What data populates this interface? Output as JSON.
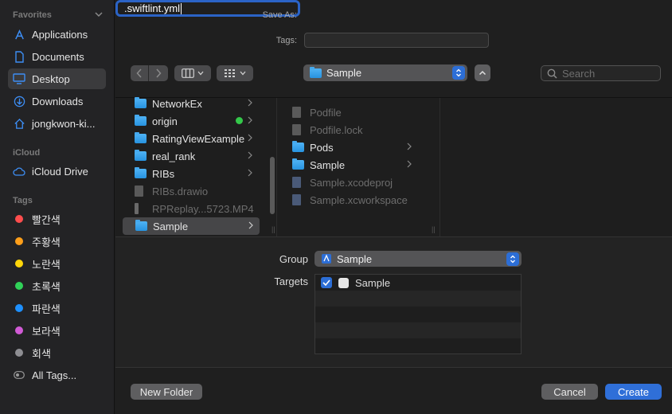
{
  "sidebar": {
    "favorites_label": "Favorites",
    "favorites": [
      {
        "label": "Applications",
        "icon": "applications-icon"
      },
      {
        "label": "Documents",
        "icon": "document-icon"
      },
      {
        "label": "Desktop",
        "icon": "desktop-icon",
        "selected": true
      },
      {
        "label": "Downloads",
        "icon": "downloads-icon"
      },
      {
        "label": "jongkwon-ki...",
        "icon": "home-icon"
      }
    ],
    "icloud_label": "iCloud",
    "icloud_drive": "iCloud Drive",
    "tags_label": "Tags",
    "tags": [
      {
        "label": "빨간색",
        "color": "#ff4d4d"
      },
      {
        "label": "주황색",
        "color": "#ff9f1a"
      },
      {
        "label": "노란색",
        "color": "#ffd60a"
      },
      {
        "label": "초록색",
        "color": "#30d158"
      },
      {
        "label": "파란색",
        "color": "#1e90ff"
      },
      {
        "label": "보라색",
        "color": "#d15bd6"
      },
      {
        "label": "회색",
        "color": "#8e8e93"
      }
    ],
    "all_tags": "All Tags..."
  },
  "header": {
    "save_as_label": "Save As:",
    "save_as_value": ".swiftlint.yml",
    "tags_label": "Tags:",
    "location": "Sample",
    "search_placeholder": "Search"
  },
  "browser": {
    "column1": [
      {
        "label": "NetworkEx",
        "type": "folder",
        "chevron": true
      },
      {
        "label": "origin",
        "type": "folder",
        "chevron": true,
        "dot": "#34c84a"
      },
      {
        "label": "RatingViewExample",
        "type": "folder",
        "chevron": true
      },
      {
        "label": "real_rank",
        "type": "folder",
        "chevron": true
      },
      {
        "label": "RIBs",
        "type": "folder",
        "chevron": true
      },
      {
        "label": "RIBs.drawio",
        "type": "file",
        "dim": true
      },
      {
        "label": "RPReplay...5723.MP4",
        "type": "file",
        "dim": true
      },
      {
        "label": "Sample",
        "type": "folder",
        "chevron": true,
        "selected": true
      }
    ],
    "column2": [
      {
        "label": "Podfile",
        "type": "file",
        "dim": true
      },
      {
        "label": "Podfile.lock",
        "type": "file",
        "dim": true
      },
      {
        "label": "Pods",
        "type": "folder",
        "chevron": true
      },
      {
        "label": "Sample",
        "type": "folder",
        "chevron": true
      },
      {
        "label": "Sample.xcodeproj",
        "type": "file",
        "dim": true
      },
      {
        "label": "Sample.xcworkspace",
        "type": "file",
        "dim": true
      }
    ]
  },
  "options": {
    "group_label": "Group",
    "group_value": "Sample",
    "targets_label": "Targets",
    "targets": [
      {
        "label": "Sample",
        "checked": true
      }
    ]
  },
  "footer": {
    "new_folder": "New Folder",
    "cancel": "Cancel",
    "create": "Create"
  },
  "colors": {
    "accent": "#2f6fd8"
  }
}
